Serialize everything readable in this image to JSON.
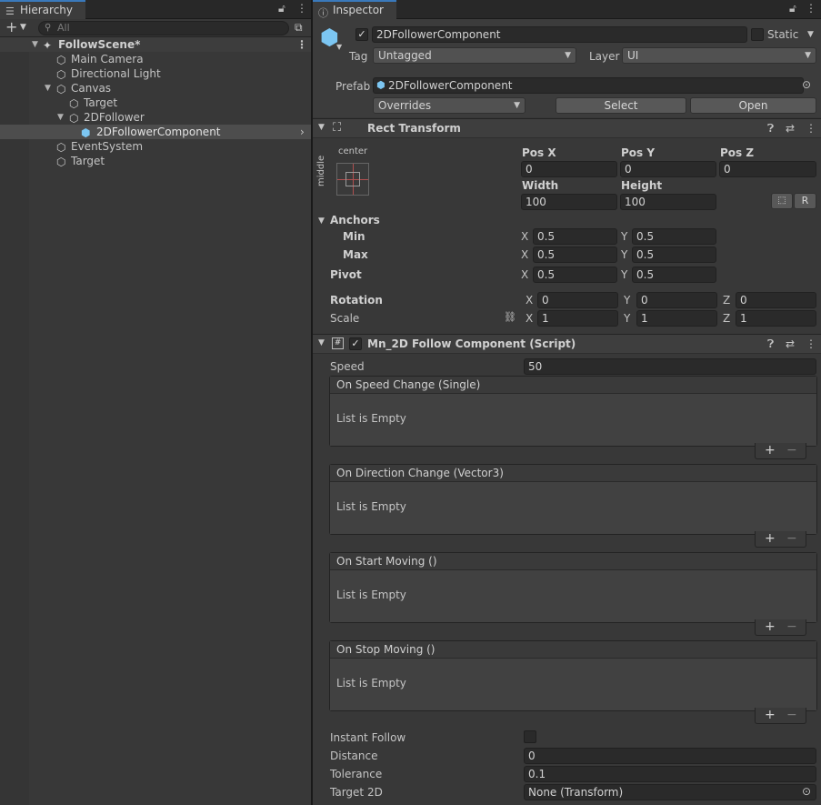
{
  "hierarchy": {
    "tab_label": "Hierarchy",
    "search_placeholder": "All",
    "items": [
      {
        "label": "FollowScene*"
      },
      {
        "label": "Main Camera"
      },
      {
        "label": "Directional Light"
      },
      {
        "label": "Canvas"
      },
      {
        "label": "Target"
      },
      {
        "label": "2DFollower"
      },
      {
        "label": "2DFollowerComponent"
      },
      {
        "label": "EventSystem"
      },
      {
        "label": "Target"
      }
    ]
  },
  "inspector": {
    "tab_label": "Inspector",
    "object_name": "2DFollowerComponent",
    "static_label": "Static",
    "tag_label": "Tag",
    "tag_value": "Untagged",
    "layer_label": "Layer",
    "layer_value": "UI",
    "prefab_label": "Prefab",
    "prefab_value": "2DFollowerComponent",
    "overrides_value": "Overrides",
    "select_label": "Select",
    "open_label": "Open",
    "rect_transform": {
      "title": "Rect Transform",
      "anchor_h": "center",
      "anchor_v": "middle",
      "pos_x_label": "Pos X",
      "pos_x": "0",
      "pos_y_label": "Pos Y",
      "pos_y": "0",
      "pos_z_label": "Pos Z",
      "pos_z": "0",
      "width_label": "Width",
      "width": "100",
      "height_label": "Height",
      "height": "100",
      "r_label": "R",
      "anchors_label": "Anchors",
      "min_label": "Min",
      "min_x": "0.5",
      "min_y": "0.5",
      "max_label": "Max",
      "max_x": "0.5",
      "max_y": "0.5",
      "pivot_label": "Pivot",
      "pivot_x": "0.5",
      "pivot_y": "0.5",
      "rotation_label": "Rotation",
      "rot_x": "0",
      "rot_y": "0",
      "rot_z": "0",
      "scale_label": "Scale",
      "scale_x": "1",
      "scale_y": "1",
      "scale_z": "1",
      "x": "X",
      "y": "Y",
      "z": "Z"
    },
    "script": {
      "title": "Mn_2D Follow Component (Script)",
      "speed_label": "Speed",
      "speed": "50",
      "events": [
        {
          "title": "On Speed Change (Single)",
          "body": "List is Empty"
        },
        {
          "title": "On Direction Change (Vector3)",
          "body": "List is Empty"
        },
        {
          "title": "On Start Moving ()",
          "body": "List is Empty"
        },
        {
          "title": "On Stop Moving ()",
          "body": "List is Empty"
        }
      ],
      "instant_follow_label": "Instant Follow",
      "distance_label": "Distance",
      "distance": "0",
      "tolerance_label": "Tolerance",
      "tolerance": "0.1",
      "target2d_label": "Target 2D",
      "target2d": "None (Transform)"
    }
  },
  "colors": {
    "accent": "#3a79bb",
    "selected_row": "#4d4d4d",
    "prefab_blue": "#7cc6f2"
  }
}
